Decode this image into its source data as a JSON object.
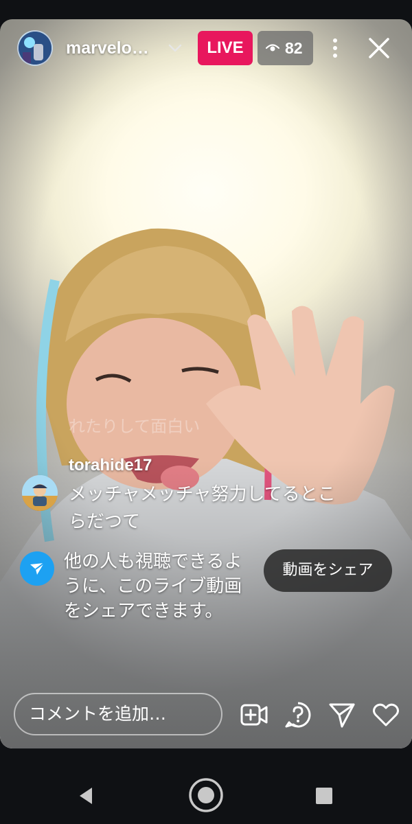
{
  "header": {
    "username": "marvelo…",
    "live_label": "LIVE",
    "viewer_count": "82"
  },
  "comments": {
    "faded_text": "れたりして面白い",
    "items": [
      {
        "username": "torahide17",
        "text": "メッチャメッチャ努力してるとこらだつて"
      }
    ]
  },
  "share_tip": {
    "text": "他の人も視聴できるように、このライブ動画をシェアできます。",
    "button_label": "動画をシェア"
  },
  "footer": {
    "comment_placeholder": "コメントを追加…"
  },
  "colors": {
    "live_badge": "#e8175d",
    "share_icon": "#1da1f2",
    "background": "#0f1114"
  },
  "icons": {
    "header": [
      "chevron-down-icon",
      "eye-icon",
      "more-vertical-icon",
      "close-icon"
    ],
    "footer": [
      "add-video-icon",
      "question-icon",
      "send-icon",
      "heart-icon"
    ],
    "system_nav": [
      "back-icon",
      "home-icon",
      "recent-apps-icon"
    ]
  }
}
